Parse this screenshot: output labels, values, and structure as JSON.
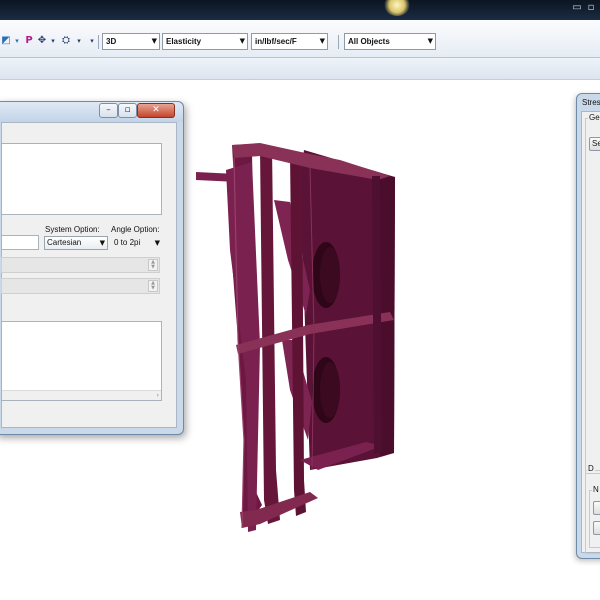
{
  "toolbar": {
    "view_mode": "3D",
    "analysis_type": "Elasticity",
    "units": "in/lbf/sec/F",
    "object_filter": "All Objects",
    "icons": [
      "select-tool-icon",
      "probe-icon",
      "measure-icon",
      "section-tool-icon",
      "dropdown-arrow-icon"
    ],
    "icon_glyphs": {
      "a": "◩",
      "b": "P",
      "c": "✥",
      "d": "⛭",
      "caret": "▾"
    }
  },
  "left_dialog": {
    "system_option_label": "System Option:",
    "system_option_value": "Cartesian",
    "angle_option_label": "Angle Option:",
    "angle_option_value": "0 to 2pi"
  },
  "right_dialog": {
    "title": "Stres",
    "tab_label": "Ge",
    "top_button_label": "Se",
    "lower_group_label": "D",
    "lower_item_label": "N"
  },
  "colors": {
    "model": "#6a1740",
    "model_dark": "#3d0a22",
    "model_light": "#8a3158"
  }
}
